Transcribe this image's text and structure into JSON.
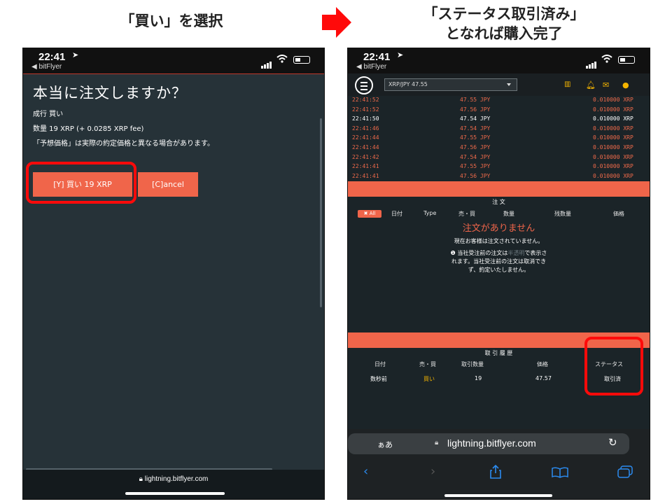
{
  "captions": {
    "left": "「買い」を選択",
    "right_line1": "「ステータス取引済み」",
    "right_line2": "となれば購入完了"
  },
  "colors": {
    "accent": "#f0654a",
    "highlight": "#ff0a0a",
    "arrow": "#ff0a0a",
    "sell": "#ef6a4a",
    "buy_price": "#ffffff",
    "status_gold": "#f4b400"
  },
  "left": {
    "status": {
      "time": "22:41",
      "back_app": "◀ bitFlyer"
    },
    "dialog": {
      "title": "本当に注文しますか？",
      "line1": "成行 買い",
      "line2": "数量 19 XRP (+ 0.0285 XRP fee)",
      "line3": "「予想価格」は実際の約定価格と異なる場合があります。",
      "buy_label": "[Y] 買い 19 XRP",
      "cancel_label": "[C]ancel"
    },
    "url": "lightning.bitflyer.com"
  },
  "right": {
    "status": {
      "time": "22:41",
      "back_app": "◀ bitFlyer"
    },
    "pair_select": "XRP/JPY 47.55",
    "icons": [
      "chart-icon",
      "bell-icon",
      "mail-icon",
      "user-icon"
    ],
    "trades": [
      {
        "time": "22:41:52",
        "price": "47.55 JPY",
        "size": "0.010000 XRP",
        "side": "sell"
      },
      {
        "time": "22:41:52",
        "price": "47.56 JPY",
        "size": "0.010000 XRP",
        "side": "sell"
      },
      {
        "time": "22:41:50",
        "price": "47.54 JPY",
        "size": "0.010000 XRP",
        "side": "buy"
      },
      {
        "time": "22:41:46",
        "price": "47.54 JPY",
        "size": "0.010000 XRP",
        "side": "sell"
      },
      {
        "time": "22:41:44",
        "price": "47.55 JPY",
        "size": "0.010000 XRP",
        "side": "sell"
      },
      {
        "time": "22:41:44",
        "price": "47.56 JPY",
        "size": "0.010000 XRP",
        "side": "sell"
      },
      {
        "time": "22:41:42",
        "price": "47.54 JPY",
        "size": "0.010000 XRP",
        "side": "sell"
      },
      {
        "time": "22:41:41",
        "price": "47.55 JPY",
        "size": "0.010000 XRP",
        "side": "sell"
      },
      {
        "time": "22:41:41",
        "price": "47.56 JPY",
        "size": "0.010000 XRP",
        "side": "sell"
      }
    ],
    "orders": {
      "section_title": "注 文",
      "all_chip": "All",
      "headers": [
        "日付",
        "Type",
        "売・買",
        "数量",
        "残数量",
        "価格"
      ],
      "empty_title": "注文がありません",
      "empty_sub": "現在お客様は注文されていません。",
      "note_line1_a": "当社受注前の注文は",
      "note_line1_b": "半透明",
      "note_line1_c": "で表示さ",
      "note_line2": "れます。当社受注前の注文は取消でき",
      "note_line3": "ず、約定いたしません。"
    },
    "history": {
      "section_title": "取 引 履 歴",
      "headers": [
        "日付",
        "売・買",
        "取引数量",
        "価格",
        "ステータス"
      ],
      "row": {
        "date": "数秒前",
        "side": "買い",
        "qty": "19",
        "price": "47.57",
        "status": "取引済"
      }
    },
    "safari": {
      "aa": "ぁあ",
      "url": "lightning.bitflyer.com"
    }
  }
}
